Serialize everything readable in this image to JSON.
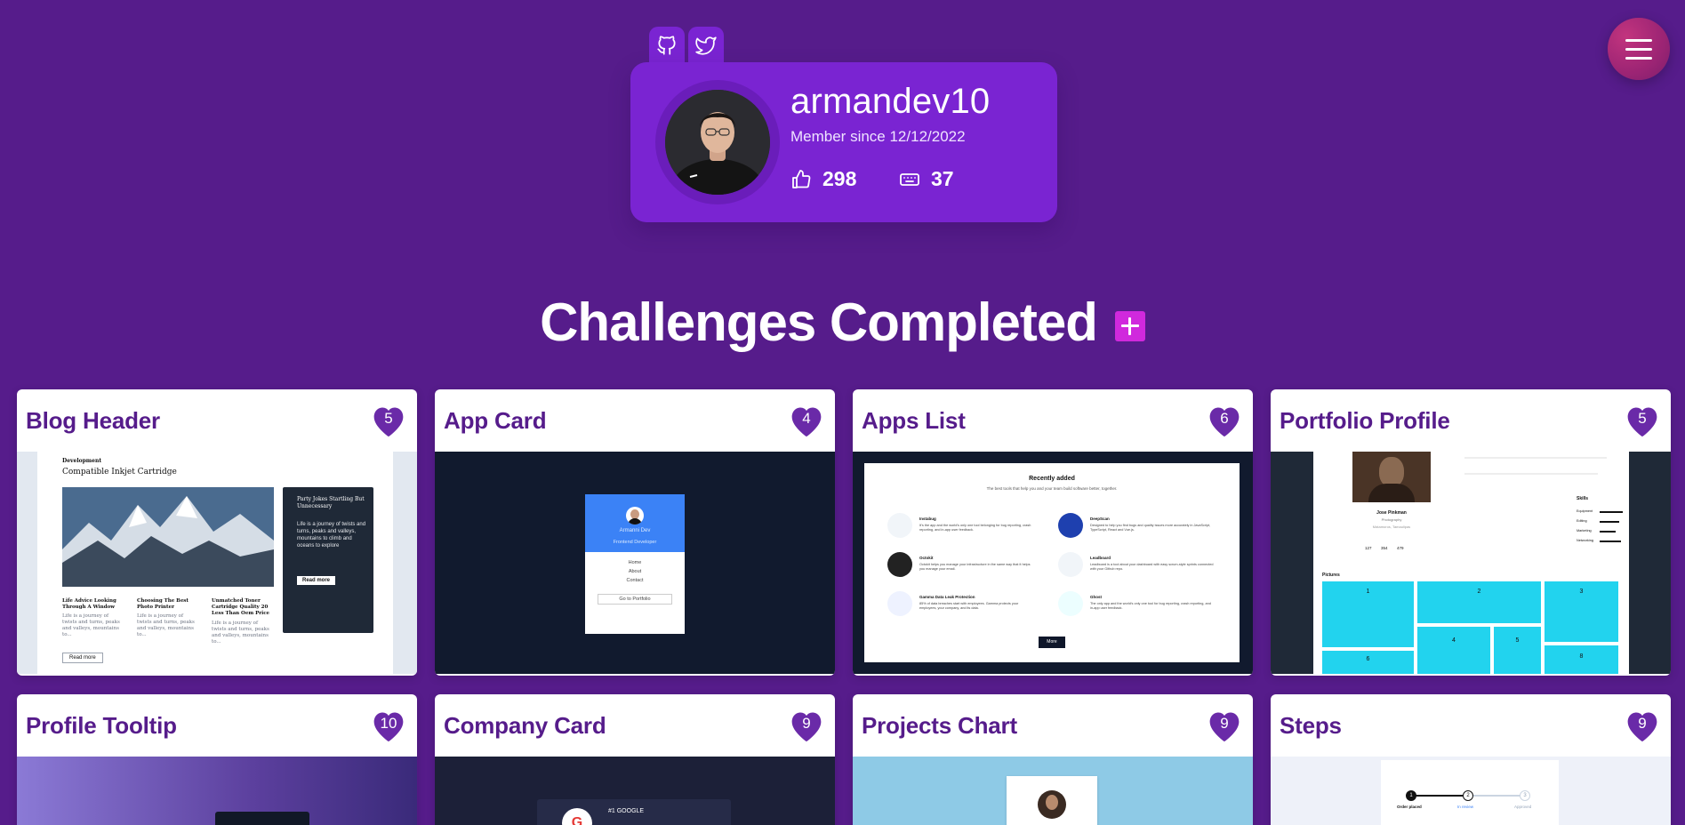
{
  "profile": {
    "username": "armandev10",
    "member_since": "Member since 12/12/2022",
    "likes": "298",
    "challenges": "37"
  },
  "social": [
    {
      "name": "github-icon"
    },
    {
      "name": "twitter-icon"
    }
  ],
  "heading": "Challenges Completed",
  "cards": [
    {
      "title": "Blog Header",
      "likes": "5"
    },
    {
      "title": "App Card",
      "likes": "4"
    },
    {
      "title": "Apps List",
      "likes": "6"
    },
    {
      "title": "Portfolio Profile",
      "likes": "5"
    },
    {
      "title": "Profile Tooltip",
      "likes": "10"
    },
    {
      "title": "Company Card",
      "likes": "9"
    },
    {
      "title": "Projects Chart",
      "likes": "9"
    },
    {
      "title": "Steps",
      "likes": "9"
    }
  ],
  "previews": {
    "blog_header": {
      "category": "Development",
      "title": "Compatible Inkjet Cartridge",
      "side_title": "Party Jokes Startling But Unnecessary",
      "side_text": "Life is a journey of twists and turns, peaks and valleys, mountains to climb and oceans to explore",
      "side_btn": "Read more",
      "col1_title": "Life Advice Looking Through A Window",
      "col2_title": "Choosing The Best Photo Printer",
      "col3_title": "Unmatched Toner Cartridge Quality 20 Less Than Oem Price",
      "col_text": "Life is a journey of twists and turns, peaks and valleys, mountains to...",
      "read_more": "Read more"
    },
    "app_card": {
      "name": "Armanni Dev",
      "role": "Frontend Developer",
      "links": [
        "Home",
        "About",
        "Contact"
      ],
      "btn": "Go to Portfolio"
    },
    "apps_list": {
      "title": "Recently added",
      "subtitle": "The best tools that help you and your team build software better, together.",
      "apps": [
        {
          "name": "Instabug",
          "text": "It's the app and the world's only one tool belonging for bug reporting, crash reporting, and in-app user feedback."
        },
        {
          "name": "DeepScan",
          "text": "Designed to help you find bugs and quality issues more accurately in JavaScript, TypeScript, React and Vue.js."
        },
        {
          "name": "Octokit",
          "text": "Octokit helps you manage your infrastructure in the same way that it helps you manage your email."
        },
        {
          "name": "Leadboard",
          "text": "Leadboard is a tool about your dashboard with easy scrum-style sprints connected with your Github repo."
        },
        {
          "name": "Gamma Data Leak Protection",
          "text": "85% of data breaches start with employees. Gamma protects your employees, your company, and its data."
        },
        {
          "name": "Ghost",
          "text": "The only app and the world's only one tool for bug reporting, crash reporting, and in-app user feedback."
        }
      ],
      "btn": "More"
    },
    "portfolio": {
      "name": "Jose Pinkman",
      "role": "Photography",
      "location": "Matamoros, Tamaulipas",
      "stats": [
        "127",
        "354",
        "479"
      ],
      "skills_title": "Skills",
      "skills": [
        "Equipment",
        "Editing",
        "Marketing",
        "Networking"
      ],
      "pictures_title": "Pictures",
      "pictures": [
        "1",
        "2",
        "3",
        "4",
        "5",
        "6",
        "8"
      ]
    },
    "company_card": {
      "rank": "#1 GOOGLE"
    },
    "steps": {
      "labels": [
        "Order placed",
        "In review",
        "Approved"
      ],
      "numbers": [
        "1",
        "2",
        "3"
      ]
    }
  },
  "colors": {
    "background": "#561c8b",
    "card_purple": "#7a24d2",
    "accent_pink": "#d029dd",
    "title_purple": "#561c8b"
  }
}
